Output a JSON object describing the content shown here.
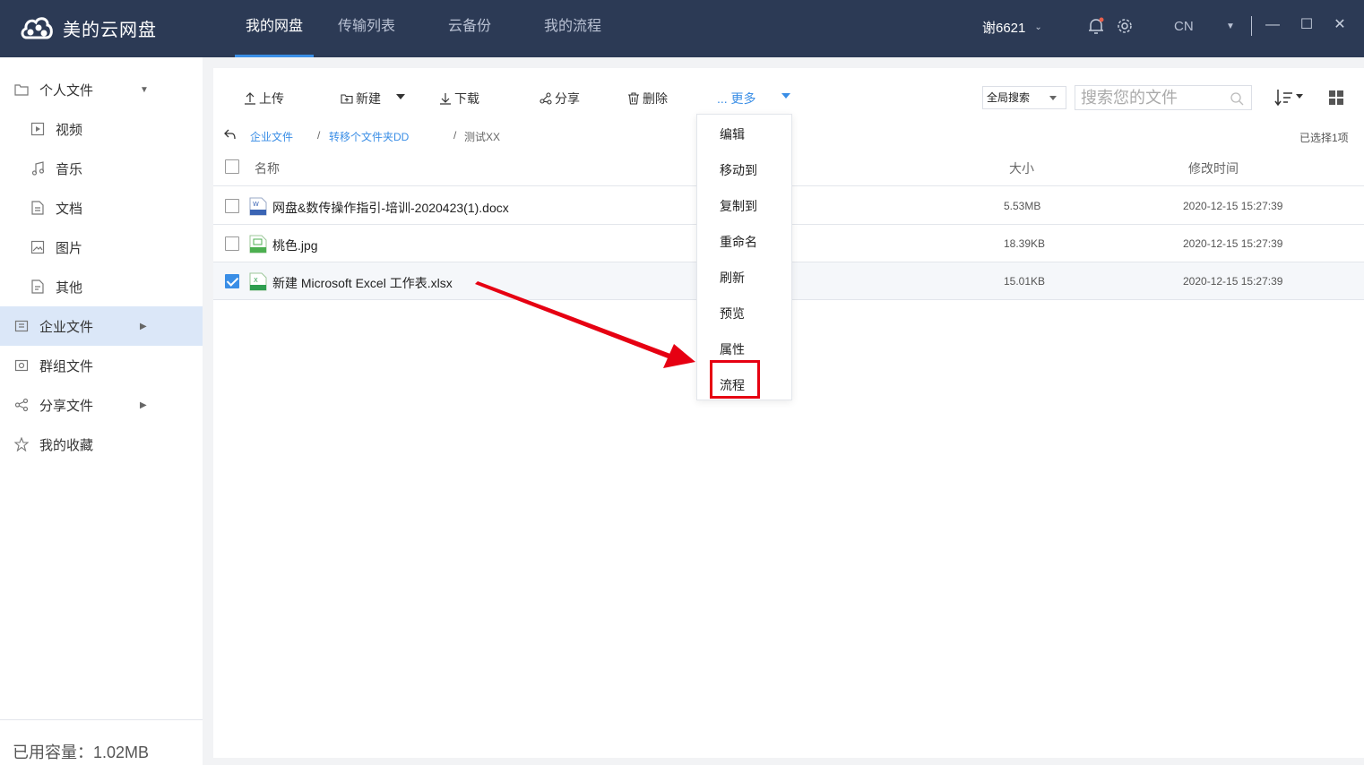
{
  "app": {
    "name": "美的云网盘"
  },
  "nav": {
    "tabs": [
      {
        "label": "我的网盘",
        "active": true
      },
      {
        "label": "传输列表",
        "active": false
      },
      {
        "label": "云备份",
        "active": false
      },
      {
        "label": "我的流程",
        "active": false
      }
    ]
  },
  "header": {
    "user": "谢6621",
    "lang": "CN"
  },
  "sidebar": {
    "items": [
      {
        "label": "个人文件"
      },
      {
        "label": "视频"
      },
      {
        "label": "音乐"
      },
      {
        "label": "文档"
      },
      {
        "label": "图片"
      },
      {
        "label": "其他"
      },
      {
        "label": "企业文件"
      },
      {
        "label": "群组文件"
      },
      {
        "label": "分享文件"
      },
      {
        "label": "我的收藏"
      }
    ],
    "usage": "已用容量：1.02MB"
  },
  "toolbar": {
    "upload": "上传",
    "new": "新建",
    "download": "下载",
    "share": "分享",
    "delete": "删除",
    "more": "... 更多",
    "scope": "全局搜索",
    "search_placeholder": "搜索您的文件"
  },
  "breadcrumb": {
    "items": [
      "企业文件",
      "转移个文件夹DD",
      "测试XX"
    ],
    "separator": "/"
  },
  "selected_info": "已选择1项",
  "table": {
    "headers": {
      "name": "名称",
      "size": "大小",
      "time": "修改时间"
    },
    "rows": [
      {
        "name": "网盘&数传操作指引-培训-2020423(1).docx",
        "size": "5.53MB",
        "time": "2020-12-15 15:27:39",
        "type": "word-icon",
        "checked": false
      },
      {
        "name": "桃色.jpg",
        "size": "18.39KB",
        "time": "2020-12-15 15:27:39",
        "type": "image-icon",
        "checked": false
      },
      {
        "name": "新建 Microsoft Excel 工作表.xlsx",
        "size": "15.01KB",
        "time": "2020-12-15 15:27:39",
        "type": "excel-icon",
        "checked": true
      }
    ]
  },
  "menu": {
    "items": [
      "编辑",
      "移动到",
      "复制到",
      "重命名",
      "刷新",
      "预览",
      "属性",
      "流程"
    ],
    "highlighted": "流程"
  },
  "colors": {
    "topbar": "#2c3a55",
    "accent": "#3a8ee6",
    "highlight": "#e60012"
  }
}
